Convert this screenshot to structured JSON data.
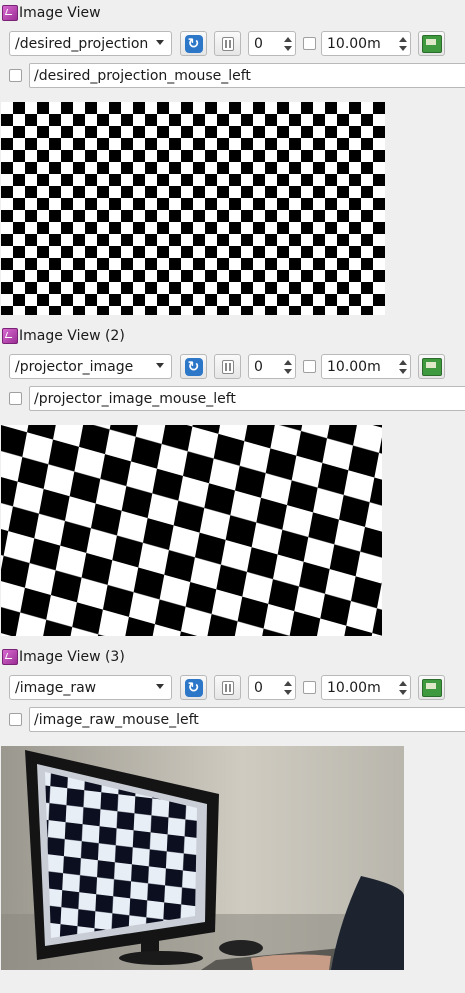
{
  "panels": [
    {
      "title": "Image View",
      "topic": "/desired_projection",
      "frame_num": "0",
      "range": "10.00m",
      "mouse_topic": "/desired_projection_mouse_left"
    },
    {
      "title": "Image View (2)",
      "topic": "/projector_image",
      "frame_num": "0",
      "range": "10.00m",
      "mouse_topic": "/projector_image_mouse_left"
    },
    {
      "title": "Image View (3)",
      "topic": "/image_raw",
      "frame_num": "0",
      "range": "10.00m",
      "mouse_topic": "/image_raw_mouse_left"
    }
  ],
  "colors": {
    "background": "#efefef",
    "refresh": "#2d77c9",
    "save": "#3f9a3f",
    "title_icon": "#c04fb9"
  },
  "icons": {
    "title": "plugin-icon",
    "refresh": "refresh-icon",
    "pause": "pause-icon",
    "save": "save-image-icon",
    "dropdown": "chevron-down-icon"
  }
}
